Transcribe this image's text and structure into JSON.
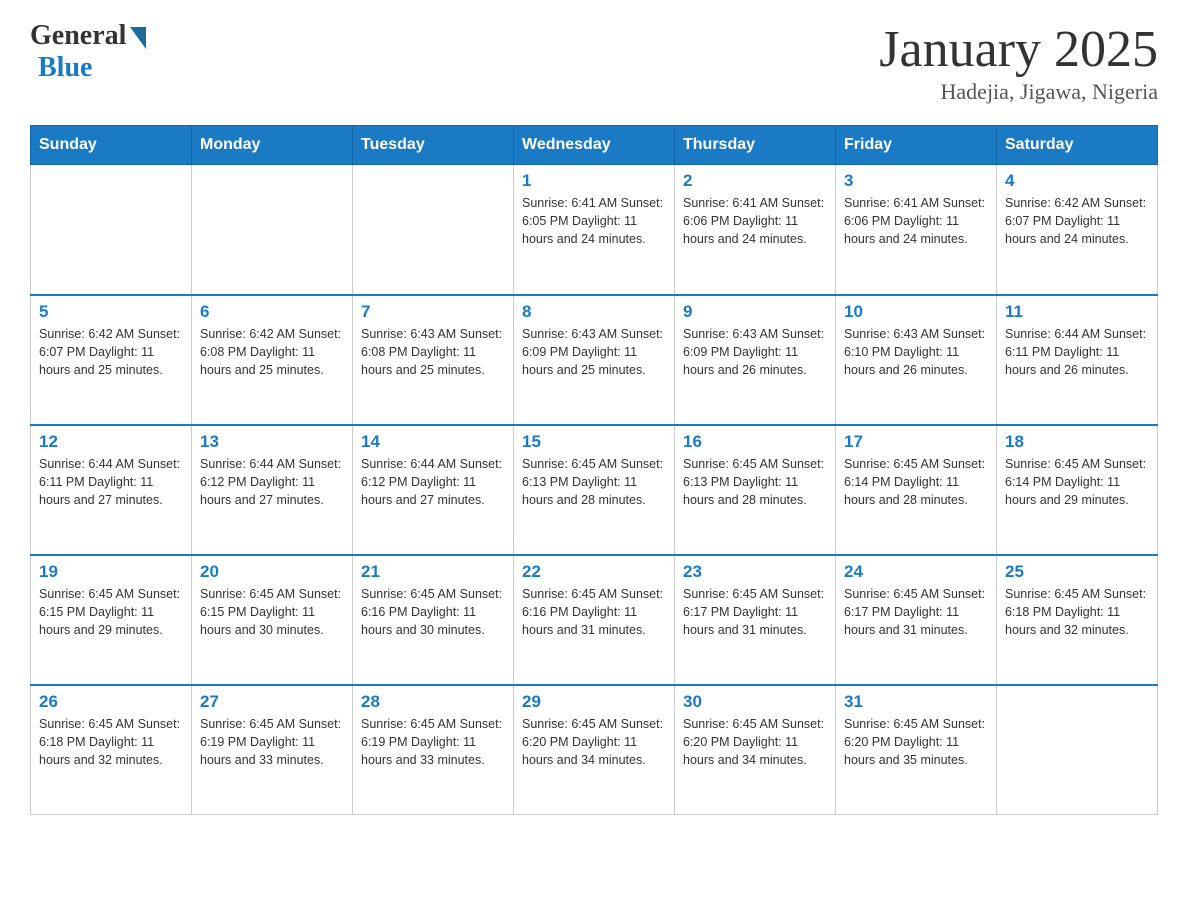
{
  "header": {
    "logo_general": "General",
    "logo_blue": "Blue",
    "month_title": "January 2025",
    "location": "Hadejia, Jigawa, Nigeria"
  },
  "days_of_week": [
    "Sunday",
    "Monday",
    "Tuesday",
    "Wednesday",
    "Thursday",
    "Friday",
    "Saturday"
  ],
  "weeks": [
    [
      {
        "day": "",
        "info": ""
      },
      {
        "day": "",
        "info": ""
      },
      {
        "day": "",
        "info": ""
      },
      {
        "day": "1",
        "info": "Sunrise: 6:41 AM\nSunset: 6:05 PM\nDaylight: 11 hours\nand 24 minutes."
      },
      {
        "day": "2",
        "info": "Sunrise: 6:41 AM\nSunset: 6:06 PM\nDaylight: 11 hours\nand 24 minutes."
      },
      {
        "day": "3",
        "info": "Sunrise: 6:41 AM\nSunset: 6:06 PM\nDaylight: 11 hours\nand 24 minutes."
      },
      {
        "day": "4",
        "info": "Sunrise: 6:42 AM\nSunset: 6:07 PM\nDaylight: 11 hours\nand 24 minutes."
      }
    ],
    [
      {
        "day": "5",
        "info": "Sunrise: 6:42 AM\nSunset: 6:07 PM\nDaylight: 11 hours\nand 25 minutes."
      },
      {
        "day": "6",
        "info": "Sunrise: 6:42 AM\nSunset: 6:08 PM\nDaylight: 11 hours\nand 25 minutes."
      },
      {
        "day": "7",
        "info": "Sunrise: 6:43 AM\nSunset: 6:08 PM\nDaylight: 11 hours\nand 25 minutes."
      },
      {
        "day": "8",
        "info": "Sunrise: 6:43 AM\nSunset: 6:09 PM\nDaylight: 11 hours\nand 25 minutes."
      },
      {
        "day": "9",
        "info": "Sunrise: 6:43 AM\nSunset: 6:09 PM\nDaylight: 11 hours\nand 26 minutes."
      },
      {
        "day": "10",
        "info": "Sunrise: 6:43 AM\nSunset: 6:10 PM\nDaylight: 11 hours\nand 26 minutes."
      },
      {
        "day": "11",
        "info": "Sunrise: 6:44 AM\nSunset: 6:11 PM\nDaylight: 11 hours\nand 26 minutes."
      }
    ],
    [
      {
        "day": "12",
        "info": "Sunrise: 6:44 AM\nSunset: 6:11 PM\nDaylight: 11 hours\nand 27 minutes."
      },
      {
        "day": "13",
        "info": "Sunrise: 6:44 AM\nSunset: 6:12 PM\nDaylight: 11 hours\nand 27 minutes."
      },
      {
        "day": "14",
        "info": "Sunrise: 6:44 AM\nSunset: 6:12 PM\nDaylight: 11 hours\nand 27 minutes."
      },
      {
        "day": "15",
        "info": "Sunrise: 6:45 AM\nSunset: 6:13 PM\nDaylight: 11 hours\nand 28 minutes."
      },
      {
        "day": "16",
        "info": "Sunrise: 6:45 AM\nSunset: 6:13 PM\nDaylight: 11 hours\nand 28 minutes."
      },
      {
        "day": "17",
        "info": "Sunrise: 6:45 AM\nSunset: 6:14 PM\nDaylight: 11 hours\nand 28 minutes."
      },
      {
        "day": "18",
        "info": "Sunrise: 6:45 AM\nSunset: 6:14 PM\nDaylight: 11 hours\nand 29 minutes."
      }
    ],
    [
      {
        "day": "19",
        "info": "Sunrise: 6:45 AM\nSunset: 6:15 PM\nDaylight: 11 hours\nand 29 minutes."
      },
      {
        "day": "20",
        "info": "Sunrise: 6:45 AM\nSunset: 6:15 PM\nDaylight: 11 hours\nand 30 minutes."
      },
      {
        "day": "21",
        "info": "Sunrise: 6:45 AM\nSunset: 6:16 PM\nDaylight: 11 hours\nand 30 minutes."
      },
      {
        "day": "22",
        "info": "Sunrise: 6:45 AM\nSunset: 6:16 PM\nDaylight: 11 hours\nand 31 minutes."
      },
      {
        "day": "23",
        "info": "Sunrise: 6:45 AM\nSunset: 6:17 PM\nDaylight: 11 hours\nand 31 minutes."
      },
      {
        "day": "24",
        "info": "Sunrise: 6:45 AM\nSunset: 6:17 PM\nDaylight: 11 hours\nand 31 minutes."
      },
      {
        "day": "25",
        "info": "Sunrise: 6:45 AM\nSunset: 6:18 PM\nDaylight: 11 hours\nand 32 minutes."
      }
    ],
    [
      {
        "day": "26",
        "info": "Sunrise: 6:45 AM\nSunset: 6:18 PM\nDaylight: 11 hours\nand 32 minutes."
      },
      {
        "day": "27",
        "info": "Sunrise: 6:45 AM\nSunset: 6:19 PM\nDaylight: 11 hours\nand 33 minutes."
      },
      {
        "day": "28",
        "info": "Sunrise: 6:45 AM\nSunset: 6:19 PM\nDaylight: 11 hours\nand 33 minutes."
      },
      {
        "day": "29",
        "info": "Sunrise: 6:45 AM\nSunset: 6:20 PM\nDaylight: 11 hours\nand 34 minutes."
      },
      {
        "day": "30",
        "info": "Sunrise: 6:45 AM\nSunset: 6:20 PM\nDaylight: 11 hours\nand 34 minutes."
      },
      {
        "day": "31",
        "info": "Sunrise: 6:45 AM\nSunset: 6:20 PM\nDaylight: 11 hours\nand 35 minutes."
      },
      {
        "day": "",
        "info": ""
      }
    ]
  ]
}
